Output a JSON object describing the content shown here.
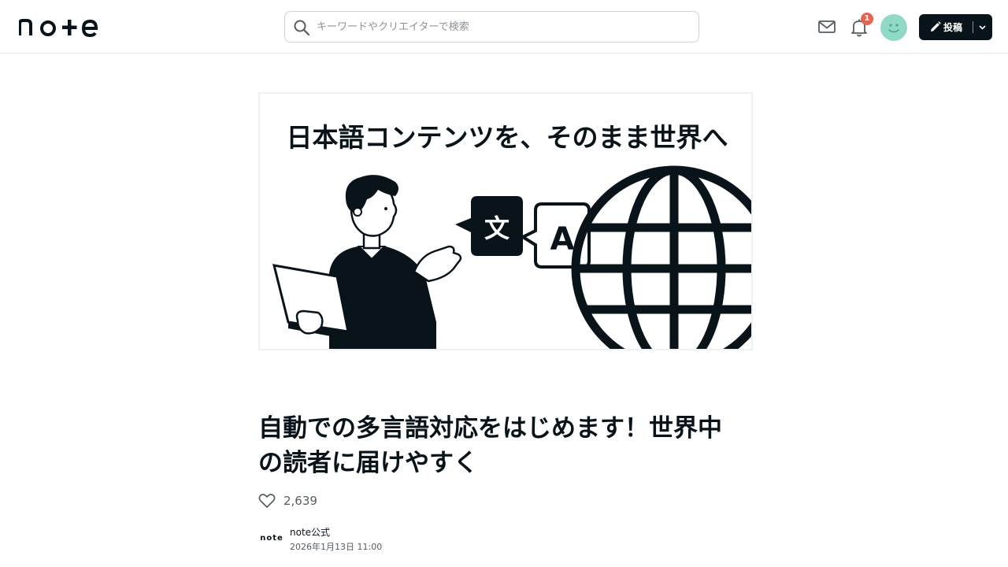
{
  "header": {
    "logo_text": "note",
    "search_placeholder": "キーワードやクリエイターで検索",
    "notification_count": "1",
    "post_label": "投稿"
  },
  "hero": {
    "heading": "日本語コンテンツを、そのまま世界へ",
    "bubble_left": "文",
    "bubble_right": "A"
  },
  "article": {
    "title_line1": "自動での多言語対応をはじめます！世界中",
    "title_line2": "の読者に届けやすく",
    "like_count": "2,639",
    "author_name": "note公式",
    "author_logo_text": "note",
    "date": "2026年1月13日 11:00"
  },
  "colors": {
    "brand_dark": "#08131a",
    "badge": "#e8634f",
    "avatar": "#8fd9c6"
  },
  "icons": [
    "search-icon",
    "mail-icon",
    "bell-icon",
    "pencil-icon",
    "chevron-down-icon",
    "heart-icon"
  ]
}
